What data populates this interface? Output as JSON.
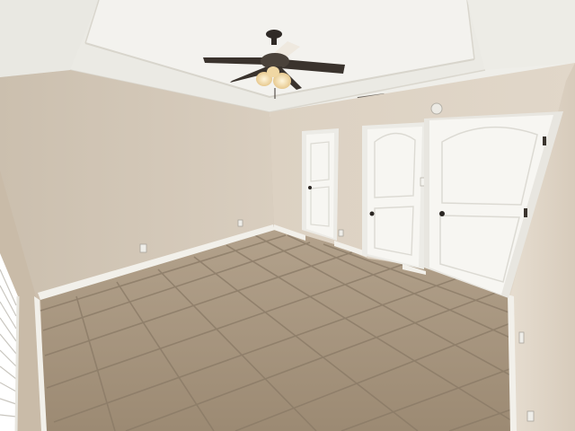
{
  "scene": {
    "subject": "empty-bedroom",
    "features": [
      "tray-ceiling",
      "ceiling-fan-with-light",
      "tile-floor",
      "three-white-doors",
      "window-blinds"
    ]
  },
  "colors": {
    "ceiling": "#efeee9",
    "ceiling_shadow": "#e3e1da",
    "tray": "#f3f2ee",
    "wall_left": "#d6cbbb",
    "wall_back": "#ddd2c3",
    "wall_right": "#e2d8ca",
    "floor": "#a8967f",
    "grout": "#8a7a66",
    "door": "#f7f6f2",
    "trim": "#f4f3ef",
    "fan_dark": "#2f2a26",
    "fan_light": "#f3d9a3"
  }
}
